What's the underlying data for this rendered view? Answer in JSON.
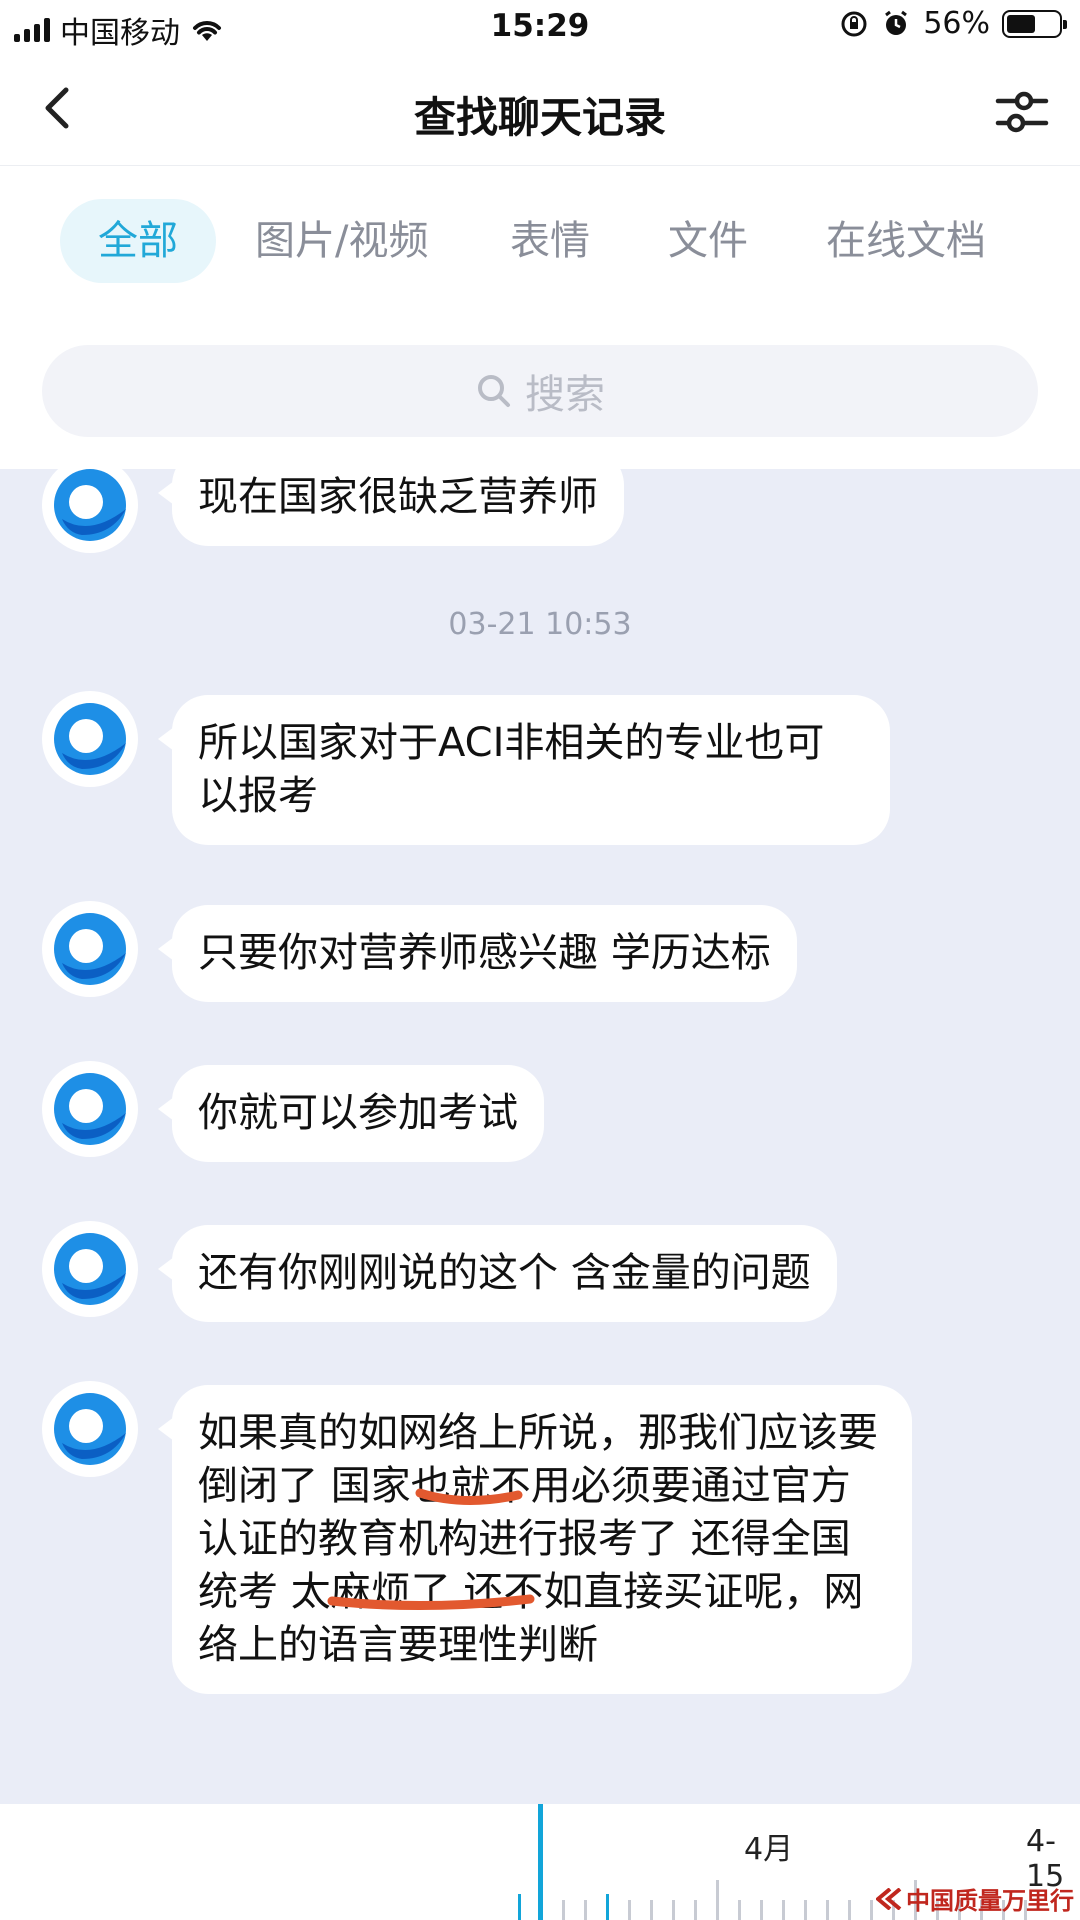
{
  "status_bar": {
    "carrier": "中国移动",
    "time": "15:29",
    "battery": "56%",
    "battery_level": 0.56
  },
  "header": {
    "title": "查找聊天记录",
    "back_icon": "chevron-left-icon",
    "filter_icon": "sliders-icon"
  },
  "tabs": [
    {
      "label": "全部",
      "active": true
    },
    {
      "label": "图片/视频",
      "active": false
    },
    {
      "label": "表情",
      "active": false
    },
    {
      "label": "文件",
      "active": false
    },
    {
      "label": "在线文档",
      "active": false
    }
  ],
  "search": {
    "placeholder": "搜索",
    "icon": "search-icon"
  },
  "messages": [
    {
      "text": "现在国家很缺乏营养师"
    },
    {
      "text": "所以国家对于ACI非相关的专业也可以报考"
    },
    {
      "text": "只要你对营养师感兴趣  学历达标"
    },
    {
      "text": "你就可以参加考试"
    },
    {
      "text": "还有你刚刚说的这个 含金量的问题"
    },
    {
      "text": "如果真的如网络上所说，那我们应该要倒闭了 国家也就不用必须要通过官方认证的教育机构进行报考了  还得全国统考 太麻烦了 还不如直接买证呢，网络上的语言要理性判断"
    }
  ],
  "timestamp": "03-21 10:53",
  "timeline": {
    "month_label": "4月",
    "date_label": "4-15"
  },
  "watermark": "中国质量万里行",
  "colors": {
    "accent": "#21a8d8",
    "chat_bg": "#eaedf7",
    "annotation": "#e2592f"
  }
}
